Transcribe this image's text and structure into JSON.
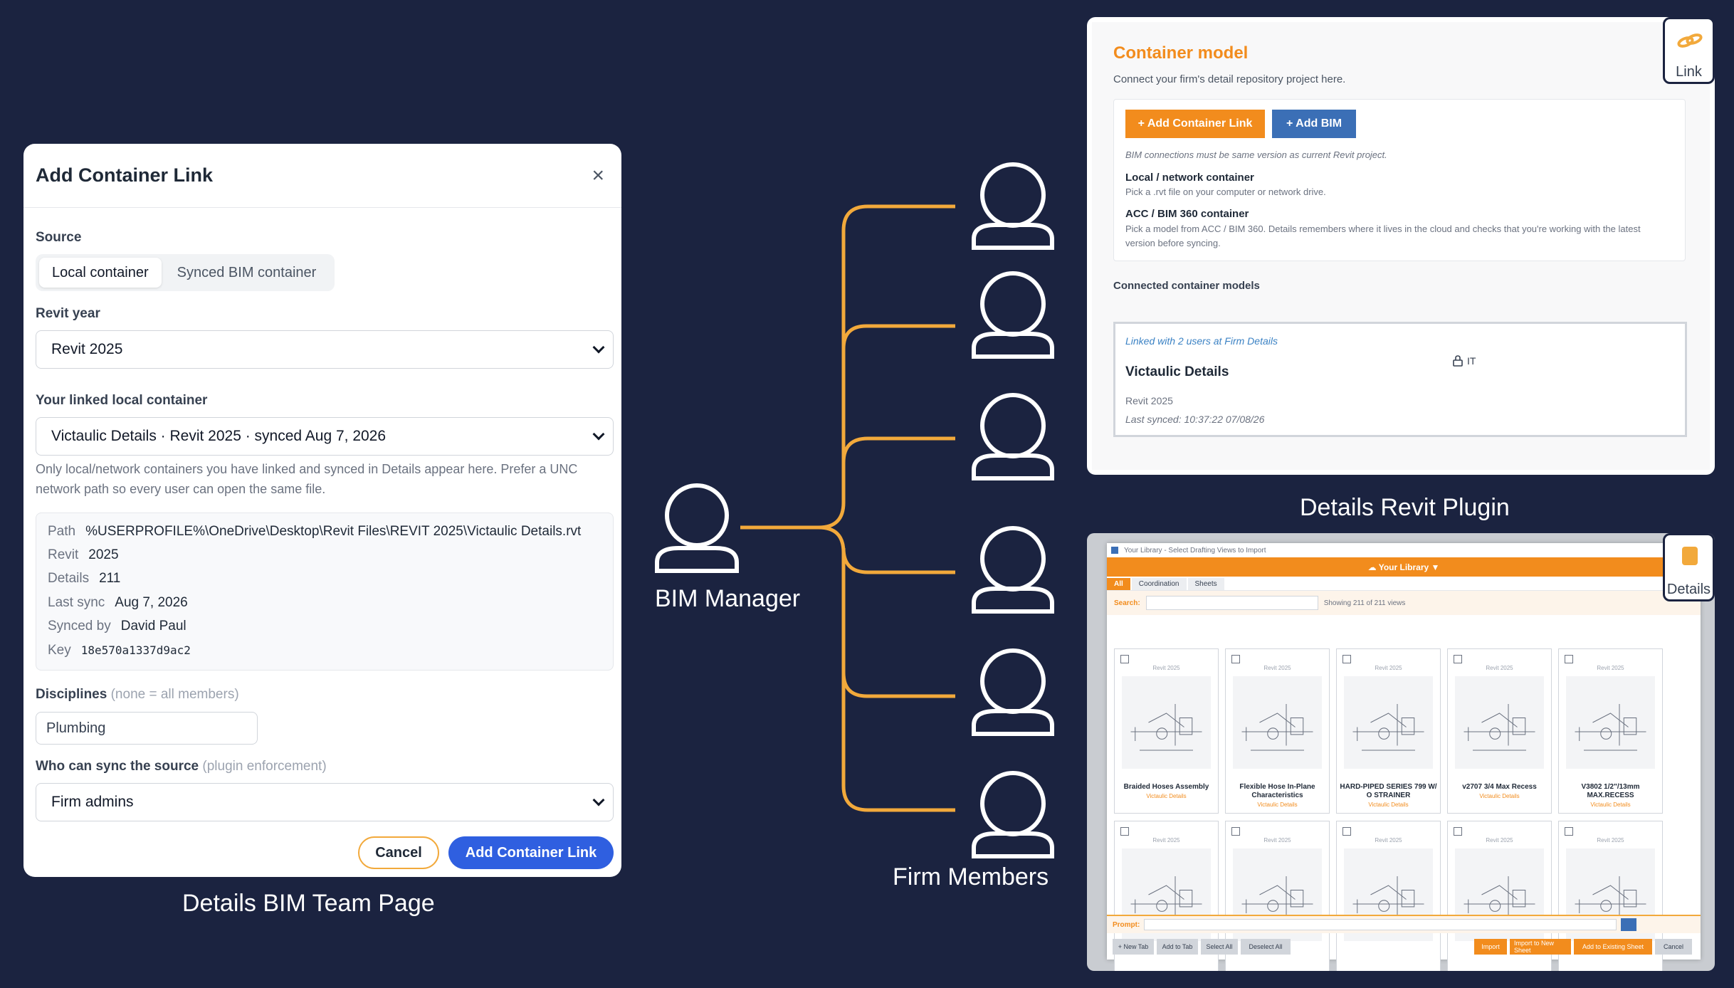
{
  "modal": {
    "title": "Add Container Link",
    "close": "×",
    "source_label": "Source",
    "source_tabs": [
      "Local container",
      "Synced BIM container"
    ],
    "revit_year_label": "Revit year",
    "revit_year_value": "Revit 2025",
    "linked_label": "Your linked local container",
    "linked_value": "Victaulic Details · Revit 2025 · synced Aug 7, 2026",
    "help_text": "Only local/network containers you have linked and synced in Details appear here. Prefer a UNC network path so every user can open the same file.",
    "info": [
      {
        "key": "Path",
        "value": "%USERPROFILE%\\OneDrive\\Desktop\\Revit Files\\REVIT 2025\\Victaulic Details.rvt"
      },
      {
        "key": "Revit",
        "value": "2025"
      },
      {
        "key": "Details",
        "value": "211"
      },
      {
        "key": "Last sync",
        "value": "Aug 7, 2026"
      },
      {
        "key": "Synced by",
        "value": "David Paul"
      },
      {
        "key": "Key",
        "value": "18e570a1337d9ac2"
      }
    ],
    "disciplines_label": "Disciplines",
    "disciplines_hint": "(none = all members)",
    "disciplines_value": "Plumbing",
    "sync_label": "Who can sync the source",
    "sync_hint": "(plugin enforcement)",
    "sync_value": "Firm admins",
    "cancel": "Cancel",
    "submit": "Add Container Link"
  },
  "captions": {
    "left": "Details BIM Team Page",
    "manager": "BIM Manager",
    "members": "Firm Members",
    "plugin": "Details Revit Plugin"
  },
  "plugin": {
    "title": "Container model",
    "subtitle": "Connect your firm's detail repository project here.",
    "btn_add_link": "+ Add Container Link",
    "btn_add_bim": "+ Add BIM",
    "note": "BIM connections must be same version as current Revit project.",
    "local_title": "Local / network container",
    "local_text": "Pick a .rvt file on your computer or network drive.",
    "acc_title": "ACC / BIM 360 container",
    "acc_text": "Pick a model from ACC / BIM 360. Details remembers where it lives in the cloud and checks that you're working with the latest version before syncing.",
    "connected_label": "Connected container models",
    "card_linked": "Linked with 2 users at Firm Details",
    "card_name": "Victaulic Details",
    "card_year": "Revit 2025",
    "card_synced": "Last synced: 10:37:22  07/08/26",
    "card_tag": "IT",
    "badge": "Link"
  },
  "library": {
    "title": "Your Library - Select Drafting Views to Import",
    "header": "☁ Your Library ▼",
    "tabs": [
      "All",
      "Coordination",
      "Sheets"
    ],
    "search_label": "Search:",
    "count": "Showing 211 of 211 views",
    "badge": "Details",
    "items": [
      {
        "year": "Revit 2025",
        "name": "Braided Hoses Assembly",
        "source": "Victaulic Details"
      },
      {
        "year": "Revit 2025",
        "name": "Flexible Hose In-Plane Characteristics",
        "source": "Victaulic Details"
      },
      {
        "year": "Revit 2025",
        "name": "HARD-PIPED SERIES 799 W/ O STRAINER",
        "source": "Victaulic Details"
      },
      {
        "year": "Revit 2025",
        "name": "v2707 3/4 Max Recess",
        "source": "Victaulic Details"
      },
      {
        "year": "Revit 2025",
        "name": "V3802 1/2\"/13mm MAX.RECESS",
        "source": "Victaulic Details"
      },
      {
        "year": "Revit 2025",
        "name": "",
        "source": ""
      },
      {
        "year": "Revit 2025",
        "name": "",
        "source": ""
      },
      {
        "year": "Revit 2025",
        "name": "",
        "source": ""
      },
      {
        "year": "Revit 2025",
        "name": "",
        "source": ""
      },
      {
        "year": "Revit 2025",
        "name": "",
        "source": ""
      }
    ],
    "prompt_label": "Prompt:",
    "footer_left": [
      "+ New Tab",
      "Add to Tab",
      "Select All",
      "Deselect All"
    ],
    "footer_right": [
      "Import",
      "Import to New Sheet",
      "Add to Existing Sheet",
      "Cancel"
    ]
  },
  "colors": {
    "background": "#1b2340",
    "accent_orange": "#f2a93b",
    "primary_blue": "#2f5fe0",
    "plugin_orange": "#f28c1d"
  }
}
